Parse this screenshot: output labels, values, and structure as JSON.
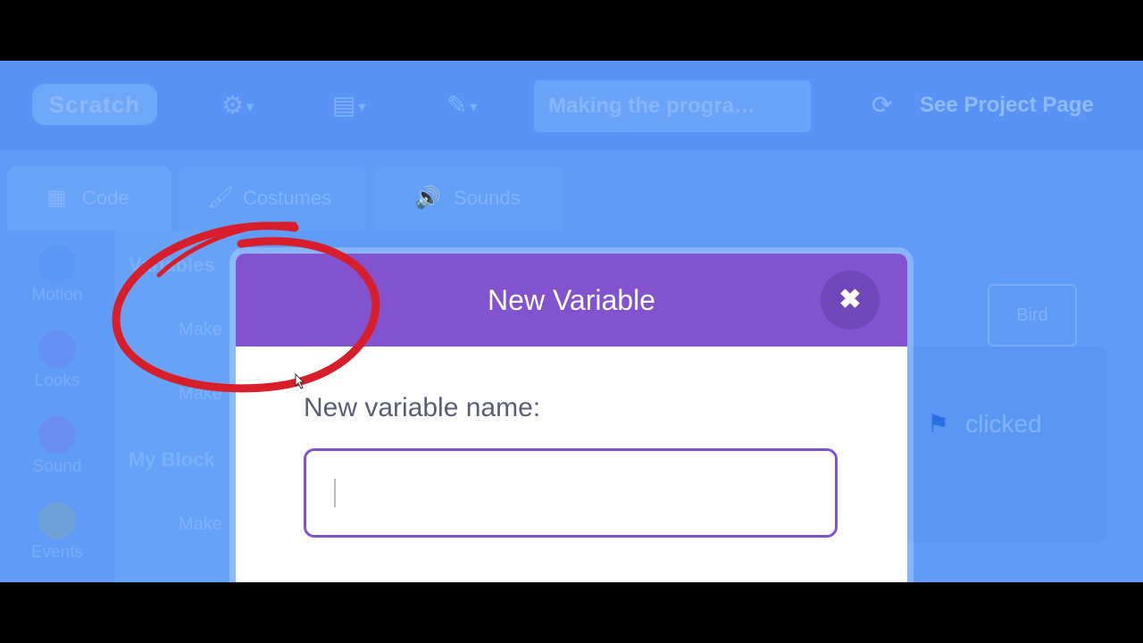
{
  "colors": {
    "backdrop": "#5e9cf7",
    "modal_header": "#8352cf",
    "annotation_red": "#d81e2a"
  },
  "menubar": {
    "logo": "Scratch",
    "settings_icon": "gear-icon",
    "file_icon": "file-icon",
    "edit_icon": "pencil-icon",
    "project_title": "Making the progra…",
    "share_icon": "refresh-icon",
    "see_project_page": "See Project Page"
  },
  "tabs": [
    {
      "label": "Code",
      "icon": "code-icon"
    },
    {
      "label": "Costumes",
      "icon": "brush-icon"
    },
    {
      "label": "Sounds",
      "icon": "speaker-icon"
    }
  ],
  "categories": [
    {
      "label": "Motion",
      "color": "#4c97ff"
    },
    {
      "label": "Looks",
      "color": "#9966ff"
    },
    {
      "label": "Sound",
      "color": "#cf63cf"
    },
    {
      "label": "Events",
      "color": "#ffbf00"
    }
  ],
  "palette": {
    "variables_heading": "Variables",
    "make_variable": "Make",
    "make_list": "Make",
    "my_blocks_heading": "My Block",
    "make_block": "Make"
  },
  "stage": {
    "sprite_label": "Bird",
    "flag_text": "clicked"
  },
  "modal": {
    "title": "New Variable",
    "close_icon": "close-icon",
    "field_label": "New variable name:",
    "input_value": ""
  }
}
